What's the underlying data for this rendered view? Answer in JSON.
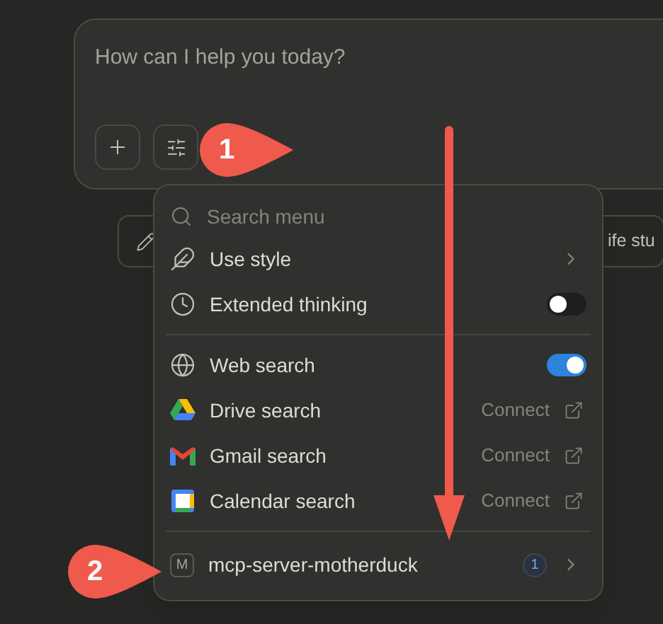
{
  "composer": {
    "placeholder": "How can I help you today?"
  },
  "chips": [
    {
      "kind": "icon"
    },
    {
      "kind": "text",
      "label": "ife stu"
    }
  ],
  "menu": {
    "search": {
      "placeholder": "Search menu"
    },
    "items": [
      {
        "kind": "submenu",
        "label": "Use style"
      },
      {
        "kind": "toggle",
        "label": "Extended thinking",
        "on": false
      },
      {
        "kind": "divider"
      },
      {
        "kind": "toggle",
        "label": "Web search",
        "on": true
      },
      {
        "kind": "connect",
        "label": "Drive search",
        "action": "Connect"
      },
      {
        "kind": "connect",
        "label": "Gmail search",
        "action": "Connect"
      },
      {
        "kind": "connect",
        "label": "Calendar search",
        "action": "Connect"
      },
      {
        "kind": "divider"
      },
      {
        "kind": "server",
        "initial": "M",
        "label": "mcp-server-motherduck",
        "badge": "1"
      }
    ]
  },
  "callouts": [
    {
      "label": "1"
    },
    {
      "label": "2"
    }
  ]
}
